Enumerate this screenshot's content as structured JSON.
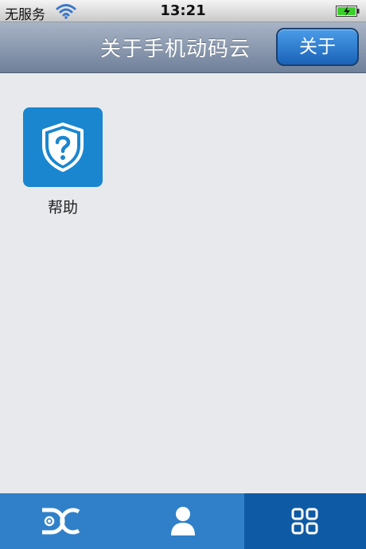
{
  "status_bar": {
    "carrier": "无服务",
    "time": "13:21"
  },
  "nav": {
    "title": "关于手机动码云",
    "right_button": "关于"
  },
  "apps": [
    {
      "label": "帮助",
      "icon": "shield-question-icon"
    }
  ],
  "tabs": [
    {
      "icon": "dc-logo-icon",
      "active": false
    },
    {
      "icon": "user-icon",
      "active": false
    },
    {
      "icon": "grid-icon",
      "active": true
    }
  ],
  "colors": {
    "tile": "#1a86d0",
    "tab_bar": "#2f80c8",
    "tab_active": "#0f5aa5",
    "battery_fill": "#3ccf2c"
  }
}
